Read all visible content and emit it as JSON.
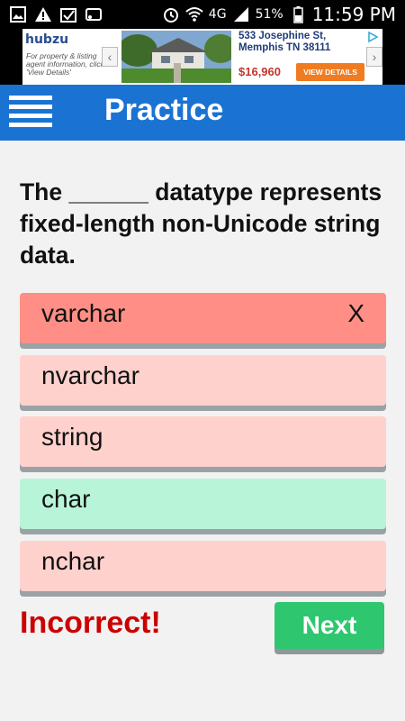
{
  "status_bar": {
    "battery_percent": "51%",
    "network": "4G",
    "time": "11:59 PM",
    "icons_left": [
      "gallery-icon",
      "warning-icon",
      "check-icon",
      "cast-icon"
    ],
    "icons_right": [
      "alarm-icon",
      "wifi-icon",
      "signal-icon",
      "battery-icon"
    ]
  },
  "ad": {
    "brand": "hubzu",
    "tagline": "For property & listing agent information, click 'View Details'",
    "address": "533 Josephine St, Memphis TN 38111",
    "price": "$16,960",
    "cta": "VIEW DETAILS"
  },
  "app_bar": {
    "title": "Practice"
  },
  "question": {
    "text": "The ______ datatype represents fixed-length non-Unicode string data."
  },
  "answers": [
    {
      "label": "varchar",
      "state": "selected-wrong",
      "mark": "X"
    },
    {
      "label": "nvarchar",
      "state": "incorrect",
      "mark": ""
    },
    {
      "label": "string",
      "state": "incorrect",
      "mark": ""
    },
    {
      "label": "char",
      "state": "correct",
      "mark": ""
    },
    {
      "label": "nchar",
      "state": "incorrect",
      "mark": ""
    }
  ],
  "feedback": {
    "result_text": "Incorrect!",
    "next_label": "Next"
  },
  "colors": {
    "app_bar": "#1a73d2",
    "selected_wrong": "#ff8f86",
    "incorrect": "#ffd1cd",
    "correct": "#b8f5d8",
    "result_text": "#cc0000",
    "next_button": "#2ec770"
  }
}
